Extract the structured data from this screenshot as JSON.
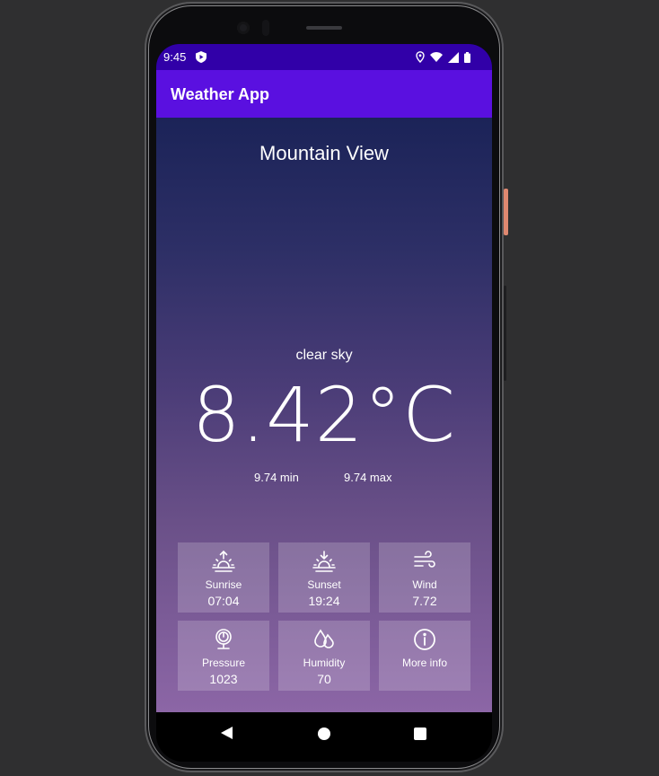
{
  "status_bar": {
    "time": "9:45",
    "icons": [
      "shield-play-icon",
      "location-icon",
      "wifi-icon",
      "signal-icon",
      "battery-icon"
    ]
  },
  "app_bar": {
    "title": "Weather App"
  },
  "weather": {
    "city": "Mountain View",
    "description": "clear sky",
    "temperature": "8.42°C",
    "min": "9.74 min",
    "max": "9.74 max"
  },
  "tiles": [
    {
      "icon": "sunrise-icon",
      "label": "Sunrise",
      "value": "07:04"
    },
    {
      "icon": "sunset-icon",
      "label": "Sunset",
      "value": "19:24"
    },
    {
      "icon": "wind-icon",
      "label": "Wind",
      "value": "7.72"
    },
    {
      "icon": "pressure-icon",
      "label": "Pressure",
      "value": "1023"
    },
    {
      "icon": "humidity-icon",
      "label": "Humidity",
      "value": "70"
    },
    {
      "icon": "info-icon",
      "label": "More info",
      "value": ""
    }
  ],
  "nav_bar": {
    "buttons": [
      "back",
      "home",
      "recents"
    ]
  },
  "colors": {
    "status_bar": "#3100a8",
    "app_bar": "#5a10e0",
    "gradient_top": "#1b2358",
    "gradient_bottom": "#8c66a6"
  }
}
